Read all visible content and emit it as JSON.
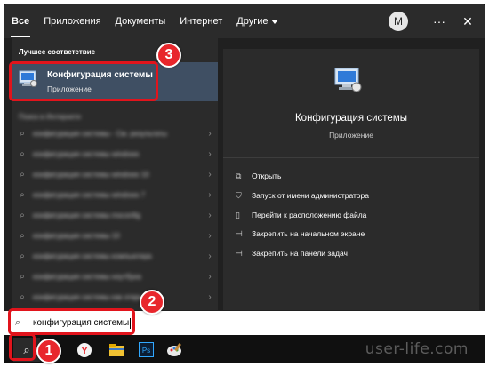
{
  "tabs": [
    {
      "label": "Все",
      "active": true
    },
    {
      "label": "Приложения"
    },
    {
      "label": "Документы"
    },
    {
      "label": "Интернет"
    },
    {
      "label": "Другие"
    }
  ],
  "header": {
    "avatar_initial": "M",
    "more_icon": "ellipsis-icon",
    "close_icon": "close-icon"
  },
  "best_match": {
    "section_title": "Лучшее соответствие",
    "title": "Конфигурация системы",
    "subtitle": "Приложение",
    "icon": "msconfig-icon"
  },
  "web_section": {
    "title": "Поиск в Интернете"
  },
  "web_suggestions": [
    "конфигурация системы - См. результаты",
    "конфигурация системы windows",
    "конфигурация системы windows 10",
    "конфигурация системы windows 7",
    "конфигурация системы msconfig",
    "конфигурация системы 10",
    "конфигурация системы компьютера",
    "конфигурация системы ноутбука",
    "конфигурация системы как открыть"
  ],
  "details": {
    "title": "Конфигурация системы",
    "subtitle": "Приложение",
    "actions": [
      {
        "label": "Открыть",
        "icon": "open-icon"
      },
      {
        "label": "Запуск от имени администратора",
        "icon": "shield-admin-icon"
      },
      {
        "label": "Перейти к расположению файла",
        "icon": "file-location-icon"
      },
      {
        "label": "Закрепить на начальном экране",
        "icon": "pin-icon"
      },
      {
        "label": "Закрепить на панели задач",
        "icon": "pin-icon"
      }
    ]
  },
  "search": {
    "value": "конфигурация системы"
  },
  "taskbar": {
    "items": [
      "search-icon",
      "yandex-browser-icon",
      "file-explorer-icon",
      "photoshop-icon",
      "paint-icon"
    ]
  },
  "callouts": {
    "one": "1",
    "two": "2",
    "three": "3"
  },
  "colors": {
    "accent_red": "#e1141c",
    "selected_bg": "#3f4f63",
    "panel_bg": "#2b2b2b"
  },
  "watermark": "user-life.com"
}
